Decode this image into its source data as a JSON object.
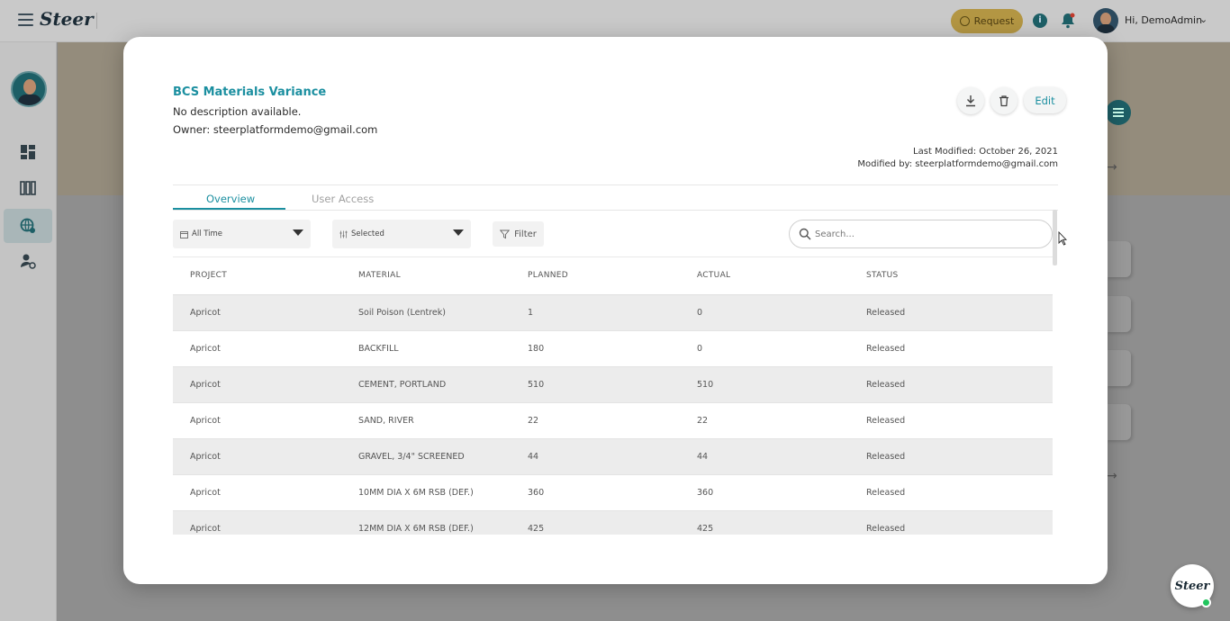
{
  "app": {
    "logo": "Steer",
    "request_label": "Request",
    "user_greeting": "Hi, DemoAdmin"
  },
  "sidebar": {
    "items": [
      {
        "icon": "dashboard-icon"
      },
      {
        "icon": "books-icon"
      },
      {
        "icon": "globe-settings-icon",
        "active": true
      },
      {
        "icon": "user-settings-icon"
      }
    ]
  },
  "modal": {
    "title": "BCS Materials Variance",
    "description": "No description available.",
    "owner": "Owner: steerplatformdemo@gmail.com",
    "edit_label": "Edit",
    "last_modified": "Last Modified: October 26, 2021",
    "modified_by": "Modified by: steerplatformdemo@gmail.com",
    "tabs": [
      {
        "label": "Overview",
        "active": true
      },
      {
        "label": "User Access",
        "active": false
      }
    ],
    "filters": {
      "time_range": "All Time",
      "columns": "Selected",
      "filter_label": "Filter",
      "search_placeholder": "Search..."
    },
    "table": {
      "headers": [
        "PROJECT",
        "MATERIAL",
        "PLANNED",
        "ACTUAL",
        "STATUS"
      ],
      "rows": [
        [
          "Apricot",
          "Soil Poison (Lentrek)",
          "1",
          "0",
          "Released"
        ],
        [
          "Apricot",
          "BACKFILL",
          "180",
          "0",
          "Released"
        ],
        [
          "Apricot",
          "CEMENT, PORTLAND",
          "510",
          "510",
          "Released"
        ],
        [
          "Apricot",
          "SAND, RIVER",
          "22",
          "22",
          "Released"
        ],
        [
          "Apricot",
          "GRAVEL, 3/4\" SCREENED",
          "44",
          "44",
          "Released"
        ],
        [
          "Apricot",
          "10MM DIA X 6M RSB (DEF.)",
          "360",
          "360",
          "Released"
        ],
        [
          "Apricot",
          "12MM DIA X 6M RSB (DEF.)",
          "425",
          "425",
          "Released"
        ]
      ]
    }
  },
  "chat": {
    "logo": "Steer"
  },
  "colors": {
    "accent": "#1b8fa0",
    "row_shade": "#ececec",
    "request": "#b39643"
  }
}
